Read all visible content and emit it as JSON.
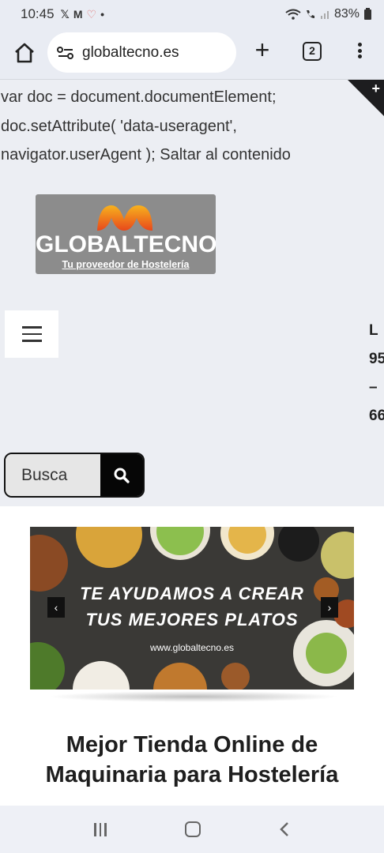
{
  "status_bar": {
    "time": "10:45",
    "battery": "83%"
  },
  "browser": {
    "url": "globaltecno.es",
    "tab_count": "2"
  },
  "page": {
    "code_text": "var doc = document.documentElement; doc.setAttribute( 'data-useragent', navigator.userAgent ); Saltar al contenido",
    "logo": {
      "brand": "GLOBALTECNO",
      "tagline": "Tu proveedor de Hostelería"
    },
    "side_text": [
      "L",
      "95",
      "–",
      "66"
    ],
    "search_placeholder": "Busca",
    "banner": {
      "line1": "TE AYUDAMOS A CREAR",
      "line2": "TUS MEJORES PLATOS",
      "site": "www.globaltecno.es"
    },
    "headline_line1": "Mejor Tienda Online de",
    "headline_line2": "Maquinaria para Hostelería"
  },
  "colors": {
    "logo_bg": "#8c8c8c",
    "logo_accent": "#f29a21",
    "search_button": "#060606"
  },
  "icons": [
    "home-icon",
    "site-info-icon",
    "plus-icon",
    "tabs-icon",
    "more-vert-icon",
    "menu-icon",
    "search-icon",
    "chevron-left-icon",
    "chevron-right-icon",
    "recent-apps-icon",
    "nav-home-icon",
    "back-icon"
  ]
}
